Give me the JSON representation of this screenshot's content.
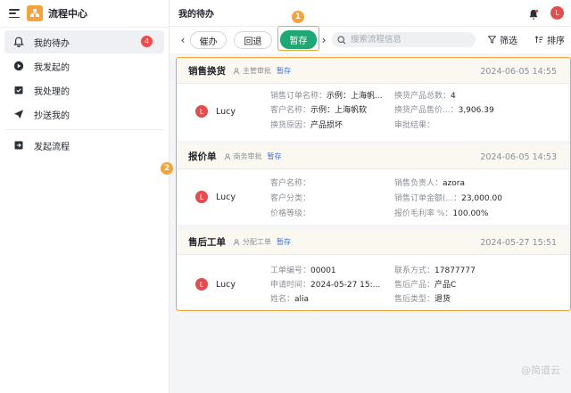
{
  "sidebar": {
    "title": "流程中心",
    "items": [
      {
        "label": "我的待办",
        "badge": "4",
        "active": true
      },
      {
        "label": "我发起的"
      },
      {
        "label": "我处理的"
      },
      {
        "label": "抄送我的"
      }
    ],
    "start_flow": "发起流程"
  },
  "header": {
    "title": "我的待办",
    "avatar": "L"
  },
  "toolbar": {
    "prev": "‹",
    "next": "›",
    "urge": "催办",
    "rollback": "回退",
    "save_draft": "暂存",
    "search_placeholder": "搜索流程信息",
    "filter": "筛选",
    "sort": "排序"
  },
  "markers": {
    "one": "1",
    "two": "2"
  },
  "cards": [
    {
      "title": "销售换货",
      "approver": "主管审批",
      "status": "暂存",
      "time": "2024-06-05 14:55",
      "user": "Lucy",
      "user_initial": "L",
      "fields": [
        {
          "k": "销售订单名称：",
          "v": "示例：上海帆..."
        },
        {
          "k": "换货产品总数：",
          "v": "4"
        },
        {
          "k": "客户名称：",
          "v": "示例：上海帆软"
        },
        {
          "k": "换货产品售价...：",
          "v": "3,906.39"
        },
        {
          "k": "换货原因：",
          "v": "产品损坏"
        },
        {
          "k": "审批结果：",
          "v": ""
        }
      ]
    },
    {
      "title": "报价单",
      "approver": "商务审批",
      "status": "暂存",
      "time": "2024-06-05 14:53",
      "user": "Lucy",
      "user_initial": "L",
      "fields": [
        {
          "k": "客户名称：",
          "v": ""
        },
        {
          "k": "销售负责人：",
          "v": "azora"
        },
        {
          "k": "客户分类：",
          "v": ""
        },
        {
          "k": "销售订单金额(...：",
          "v": "23,000.00"
        },
        {
          "k": "价格等级：",
          "v": ""
        },
        {
          "k": "报价毛利率 %：",
          "v": "100.00%"
        }
      ]
    },
    {
      "title": "售后工单",
      "approver": "分配工单",
      "status": "暂存",
      "time": "2024-05-27 15:51",
      "user": "Lucy",
      "user_initial": "L",
      "fields": [
        {
          "k": "工单编号：",
          "v": "00001"
        },
        {
          "k": "联系方式：",
          "v": "17877777"
        },
        {
          "k": "申请时间：",
          "v": "2024-05-27 15:..."
        },
        {
          "k": "售后产品：",
          "v": "产品C"
        },
        {
          "k": "姓名：",
          "v": "alia"
        },
        {
          "k": "售后类型：",
          "v": "退货"
        }
      ]
    }
  ],
  "watermark": "@简道云",
  "colors": {
    "accent": "#1fa774",
    "highlight": "#f5a33a",
    "badge": "#ef4b4b",
    "status": "#3874d8"
  }
}
